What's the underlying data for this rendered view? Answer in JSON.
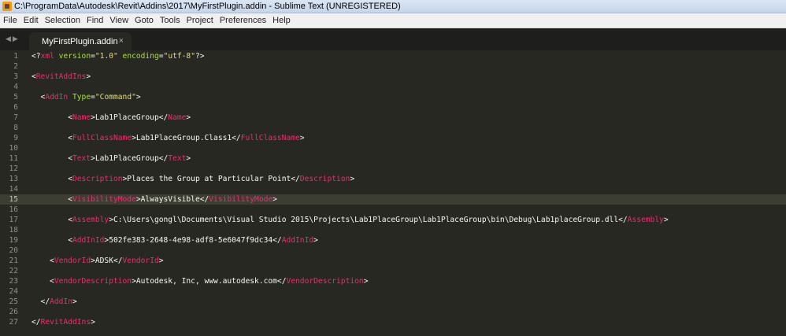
{
  "window": {
    "title": "C:\\ProgramData\\Autodesk\\Revit\\Addins\\2017\\MyFirstPlugin.addin - Sublime Text (UNREGISTERED)"
  },
  "menu": [
    "File",
    "Edit",
    "Selection",
    "Find",
    "View",
    "Goto",
    "Tools",
    "Project",
    "Preferences",
    "Help"
  ],
  "tab": {
    "label": "MyFirstPlugin.addin",
    "close": "×"
  },
  "nav": {
    "back": "◀",
    "forward": "▶"
  },
  "editor": {
    "current_line": 15,
    "lines": [
      [
        {
          "t": "pu",
          "v": "<?"
        },
        {
          "t": "tg",
          "v": "xml"
        },
        {
          "t": "at",
          "v": " version"
        },
        {
          "t": "pu",
          "v": "="
        },
        {
          "t": "st",
          "v": "\"1.0\""
        },
        {
          "t": "at",
          "v": " encoding"
        },
        {
          "t": "pu",
          "v": "="
        },
        {
          "t": "st",
          "v": "\"utf-8\""
        },
        {
          "t": "pu",
          "v": "?>"
        }
      ],
      [],
      [
        {
          "t": "pu",
          "v": "<"
        },
        {
          "t": "tg",
          "v": "RevitAddIns"
        },
        {
          "t": "pu",
          "v": ">"
        }
      ],
      [],
      [
        {
          "t": "pu",
          "v": "  <"
        },
        {
          "t": "tg",
          "v": "AddIn"
        },
        {
          "t": "at",
          "v": " Type"
        },
        {
          "t": "pu",
          "v": "="
        },
        {
          "t": "st",
          "v": "\"Command\""
        },
        {
          "t": "pu",
          "v": ">"
        }
      ],
      [],
      [
        {
          "t": "pu",
          "v": "        <"
        },
        {
          "t": "tg",
          "v": "Name"
        },
        {
          "t": "pu",
          "v": ">Lab1PlaceGroup</"
        },
        {
          "t": "tg",
          "v": "Name"
        },
        {
          "t": "pu",
          "v": ">"
        }
      ],
      [],
      [
        {
          "t": "pu",
          "v": "        <"
        },
        {
          "t": "tg",
          "v": "FullClassName"
        },
        {
          "t": "pu",
          "v": ">Lab1PlaceGroup.Class1</"
        },
        {
          "t": "tg",
          "v": "FullClassName"
        },
        {
          "t": "pu",
          "v": ">"
        }
      ],
      [],
      [
        {
          "t": "pu",
          "v": "        <"
        },
        {
          "t": "tg",
          "v": "Text"
        },
        {
          "t": "pu",
          "v": ">Lab1PlaceGroup</"
        },
        {
          "t": "tg",
          "v": "Text"
        },
        {
          "t": "pu",
          "v": ">"
        }
      ],
      [],
      [
        {
          "t": "pu",
          "v": "        <"
        },
        {
          "t": "tg",
          "v": "Description"
        },
        {
          "t": "pu",
          "v": ">Places the Group at Particular Point</"
        },
        {
          "t": "tg",
          "v": "Description"
        },
        {
          "t": "pu",
          "v": ">"
        }
      ],
      [],
      [
        {
          "t": "pu",
          "v": "        <"
        },
        {
          "t": "tg",
          "v": "VisibilityMode"
        },
        {
          "t": "pu",
          "v": ">AlwaysVisible</"
        },
        {
          "t": "tg",
          "v": "VisibilityMode"
        },
        {
          "t": "pu",
          "v": ">"
        }
      ],
      [],
      [
        {
          "t": "pu",
          "v": "        <"
        },
        {
          "t": "tg",
          "v": "Assembly"
        },
        {
          "t": "pu",
          "v": ">C:\\Users\\gongl\\Documents\\Visual Studio 2015\\Projects\\Lab1PlaceGroup\\Lab1PlaceGroup\\bin\\Debug\\Lab1placeGroup.dll</"
        },
        {
          "t": "tg",
          "v": "Assembly"
        },
        {
          "t": "pu",
          "v": ">"
        }
      ],
      [],
      [
        {
          "t": "pu",
          "v": "        <"
        },
        {
          "t": "tg",
          "v": "AddInId"
        },
        {
          "t": "pu",
          "v": ">502fe383-2648-4e98-adf8-5e6047f9dc34</"
        },
        {
          "t": "tg",
          "v": "AddInId"
        },
        {
          "t": "pu",
          "v": ">"
        }
      ],
      [],
      [
        {
          "t": "pu",
          "v": "    <"
        },
        {
          "t": "tg",
          "v": "VendorId"
        },
        {
          "t": "pu",
          "v": ">ADSK</"
        },
        {
          "t": "tg",
          "v": "VendorId"
        },
        {
          "t": "pu",
          "v": ">"
        }
      ],
      [],
      [
        {
          "t": "pu",
          "v": "    <"
        },
        {
          "t": "tg",
          "v": "VendorDescription"
        },
        {
          "t": "pu",
          "v": ">Autodesk, Inc, www.autodesk.com</"
        },
        {
          "t": "tg",
          "v": "VendorDescription"
        },
        {
          "t": "pu",
          "v": ">"
        }
      ],
      [],
      [
        {
          "t": "pu",
          "v": "  </"
        },
        {
          "t": "tg",
          "v": "AddIn"
        },
        {
          "t": "pu",
          "v": ">"
        }
      ],
      [],
      [
        {
          "t": "pu",
          "v": "</"
        },
        {
          "t": "tg",
          "v": "RevitAddIns"
        },
        {
          "t": "pu",
          "v": ">"
        }
      ]
    ]
  }
}
